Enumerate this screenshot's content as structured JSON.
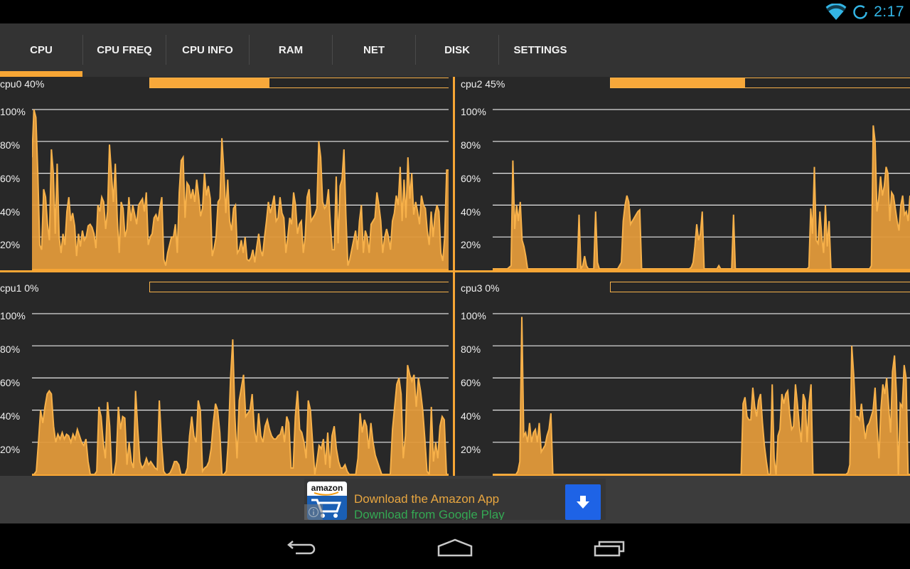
{
  "status_bar": {
    "time": "2:17",
    "icons": [
      "wifi-icon",
      "sync-icon"
    ],
    "accent_color": "#33b5e5"
  },
  "tabs": [
    {
      "label": "CPU",
      "active": true
    },
    {
      "label": "CPU FREQ",
      "active": false
    },
    {
      "label": "CPU INFO",
      "active": false
    },
    {
      "label": "RAM",
      "active": false
    },
    {
      "label": "NET",
      "active": false
    },
    {
      "label": "DISK",
      "active": false
    },
    {
      "label": "SETTINGS",
      "active": false
    }
  ],
  "theme": {
    "accent": "#f7a635",
    "graph_fill": "#e0993a",
    "graph_line": "#f7b14a",
    "background": "#282828"
  },
  "y_axis_labels": [
    "100%",
    "80%",
    "60%",
    "40%",
    "20%"
  ],
  "cpus": [
    {
      "name": "cpu0",
      "title": "cpu0 40%",
      "usage_percent": 40,
      "history": [
        70,
        100,
        95,
        60,
        15,
        12,
        50,
        45,
        28,
        18,
        75,
        60,
        22,
        66,
        20,
        10,
        22,
        15,
        36,
        45,
        30,
        35,
        27,
        8,
        22,
        14,
        24,
        18,
        20,
        27,
        28,
        26,
        22,
        13,
        40,
        36,
        45,
        42,
        25,
        36,
        78,
        60,
        42,
        66,
        32,
        10,
        42,
        38,
        20,
        25,
        45,
        30,
        40,
        34,
        28,
        40,
        42,
        44,
        36,
        48,
        15,
        20,
        22,
        32,
        34,
        30,
        38,
        45,
        6,
        2,
        10,
        15,
        20,
        20,
        28,
        10,
        48,
        68,
        70,
        32,
        54,
        52,
        44,
        50,
        42,
        56,
        46,
        33,
        38,
        60,
        46,
        52,
        44,
        8,
        13,
        20,
        42,
        44,
        82,
        62,
        35,
        56,
        30,
        24,
        38,
        40,
        10,
        12,
        18,
        10,
        20,
        6,
        5,
        7,
        12,
        4,
        14,
        22,
        12,
        8,
        20,
        30,
        42,
        35,
        40,
        46,
        30,
        32,
        45,
        35,
        32,
        10,
        20,
        32,
        28,
        48,
        40,
        22,
        28,
        30,
        10,
        20,
        45,
        50,
        30,
        32,
        34,
        38,
        80,
        70,
        42,
        38,
        40,
        50,
        28,
        12,
        12,
        58,
        16,
        52,
        56,
        75,
        34,
        2,
        6,
        12,
        18,
        24,
        12,
        30,
        40,
        10,
        24,
        20,
        10,
        28,
        30,
        32,
        48,
        40,
        30,
        10,
        20,
        25,
        20,
        12,
        30,
        35,
        46,
        40,
        64,
        30,
        56,
        32,
        70,
        44,
        60,
        34,
        42,
        36,
        28,
        46,
        40,
        38,
        24,
        15,
        36,
        20,
        34,
        40,
        36,
        10,
        5,
        20,
        62,
        62
      ]
    },
    {
      "name": "cpu1",
      "title": "cpu1 0%",
      "usage_percent": 0,
      "history": [
        0,
        0,
        2,
        20,
        40,
        32,
        42,
        50,
        52,
        50,
        30,
        20,
        25,
        22,
        26,
        22,
        25,
        24,
        20,
        25,
        22,
        28,
        24,
        20,
        18,
        22,
        8,
        0,
        0,
        0,
        2,
        42,
        36,
        20,
        10,
        45,
        30,
        0,
        0,
        8,
        42,
        28,
        36,
        35,
        6,
        20,
        8,
        4,
        52,
        28,
        8,
        4,
        6,
        10,
        6,
        8,
        6,
        4,
        3,
        46,
        20,
        2,
        0,
        0,
        1,
        4,
        8,
        8,
        6,
        0,
        0,
        0,
        4,
        24,
        36,
        24,
        20,
        46,
        40,
        2,
        4,
        5,
        8,
        16,
        32,
        44,
        40,
        26,
        0,
        0,
        2,
        22,
        60,
        84,
        36,
        10,
        46,
        54,
        62,
        36,
        38,
        40,
        50,
        28,
        20,
        38,
        24,
        20,
        30,
        34,
        28,
        24,
        22,
        22,
        24,
        25,
        30,
        20,
        36,
        32,
        4,
        4,
        36,
        52,
        28,
        26,
        20,
        10,
        46,
        40,
        20,
        0,
        8,
        18,
        16,
        22,
        6,
        26,
        4,
        24,
        30,
        16,
        8,
        4,
        4,
        6,
        2,
        0,
        0,
        0,
        0,
        10,
        38,
        26,
        34,
        30,
        16,
        32,
        20,
        12,
        8,
        4,
        0,
        0,
        0,
        0,
        0,
        28,
        42,
        56,
        60,
        50,
        10,
        24,
        68,
        62,
        58,
        62,
        42,
        60,
        52,
        40,
        22,
        2,
        0,
        42,
        8,
        20,
        10,
        30,
        36,
        34,
        0,
        0
      ]
    },
    {
      "name": "cpu2",
      "title": "cpu2 45%",
      "usage_percent": 45,
      "history": [
        0,
        0,
        0,
        0,
        0,
        0,
        0,
        0,
        0,
        1,
        2,
        68,
        25,
        40,
        30,
        42,
        18,
        14,
        8,
        0,
        0,
        0,
        0,
        0,
        0,
        0,
        0,
        0,
        0,
        0,
        0,
        0,
        0,
        0,
        0,
        0,
        0,
        0,
        0,
        0,
        0,
        0,
        0,
        0,
        0,
        0,
        0,
        34,
        0,
        2,
        8,
        2,
        0,
        0,
        0,
        0,
        36,
        4,
        0,
        0,
        0,
        0,
        0,
        0,
        0,
        0,
        0,
        0,
        0,
        2,
        4,
        30,
        40,
        46,
        42,
        28,
        30,
        32,
        34,
        36,
        37,
        0,
        0,
        0,
        0,
        0,
        0,
        0,
        0,
        0,
        0,
        0,
        0,
        0,
        0,
        0,
        0,
        0,
        0,
        0,
        0,
        0,
        0,
        0,
        0,
        0,
        0,
        0,
        1,
        4,
        14,
        28,
        18,
        22,
        36,
        0,
        0,
        0,
        0,
        0,
        0,
        0,
        0,
        2,
        0,
        0,
        0,
        0,
        0,
        0,
        0,
        34,
        0,
        0,
        0,
        0,
        0,
        0,
        0,
        0,
        0,
        0,
        0,
        0,
        0,
        0,
        0,
        0,
        0,
        0,
        0,
        0,
        0,
        0,
        0,
        0,
        0,
        0,
        0,
        0,
        0,
        0,
        0,
        0,
        0,
        0,
        0,
        0,
        0,
        0,
        0,
        0,
        1,
        38,
        22,
        64,
        18,
        16,
        36,
        20,
        10,
        40,
        14,
        30,
        0,
        0,
        0,
        0,
        0,
        0,
        0,
        0,
        0,
        0,
        0,
        0,
        0,
        0,
        0,
        0,
        0,
        0,
        0,
        0,
        0,
        0,
        2,
        90,
        80,
        36,
        44,
        58,
        46,
        52,
        64,
        60,
        30,
        48,
        46,
        38,
        30,
        24,
        40,
        46,
        34,
        36,
        30,
        46
      ]
    },
    {
      "name": "cpu3",
      "title": "cpu3 0%",
      "usage_percent": 0,
      "history": [
        0,
        0,
        0,
        0,
        0,
        0,
        0,
        0,
        0,
        0,
        0,
        0,
        0,
        2,
        8,
        98,
        24,
        26,
        20,
        32,
        20,
        26,
        28,
        20,
        32,
        14,
        16,
        18,
        24,
        28,
        38,
        0,
        0,
        0,
        0,
        0,
        0,
        0,
        0,
        0,
        0,
        0,
        0,
        0,
        0,
        0,
        0,
        0,
        0,
        0,
        0,
        0,
        0,
        0,
        0,
        0,
        0,
        0,
        0,
        0,
        0,
        0,
        0,
        0,
        0,
        0,
        0,
        0,
        0,
        0,
        0,
        0,
        0,
        0,
        0,
        0,
        0,
        0,
        0,
        0,
        0,
        0,
        0,
        0,
        0,
        0,
        0,
        0,
        0,
        0,
        0,
        0,
        0,
        0,
        0,
        0,
        0,
        0,
        0,
        0,
        0,
        0,
        0,
        0,
        0,
        0,
        0,
        0,
        0,
        0,
        0,
        0,
        0,
        0,
        0,
        0,
        0,
        0,
        0,
        0,
        0,
        0,
        0,
        0,
        0,
        0,
        0,
        0,
        0,
        44,
        48,
        36,
        34,
        34,
        54,
        42,
        36,
        46,
        50,
        32,
        18,
        8,
        0,
        0,
        56,
        10,
        0,
        24,
        28,
        50,
        44,
        50,
        52,
        38,
        28,
        30,
        56,
        44,
        30,
        20,
        50,
        46,
        20,
        44,
        56,
        0,
        0,
        0,
        0,
        0,
        0,
        0,
        0,
        0,
        0,
        0,
        0,
        0,
        0,
        0,
        0,
        0,
        0,
        1,
        6,
        80,
        62,
        36,
        36,
        34,
        44,
        32,
        22,
        30,
        32,
        36,
        40,
        54,
        30,
        10,
        40,
        56,
        50,
        60,
        42,
        26,
        64,
        74,
        50,
        0,
        44,
        42,
        68,
        60,
        0,
        0
      ]
    }
  ],
  "ad": {
    "logo_text": "amazon",
    "title": "Download the Amazon App",
    "subtitle": "Download from Google Play",
    "title_color": "#e8a640",
    "subtitle_color": "#34a853",
    "button_color": "#1e63e6"
  },
  "nav_bar": {
    "buttons": [
      "back",
      "home",
      "recent-apps"
    ]
  }
}
